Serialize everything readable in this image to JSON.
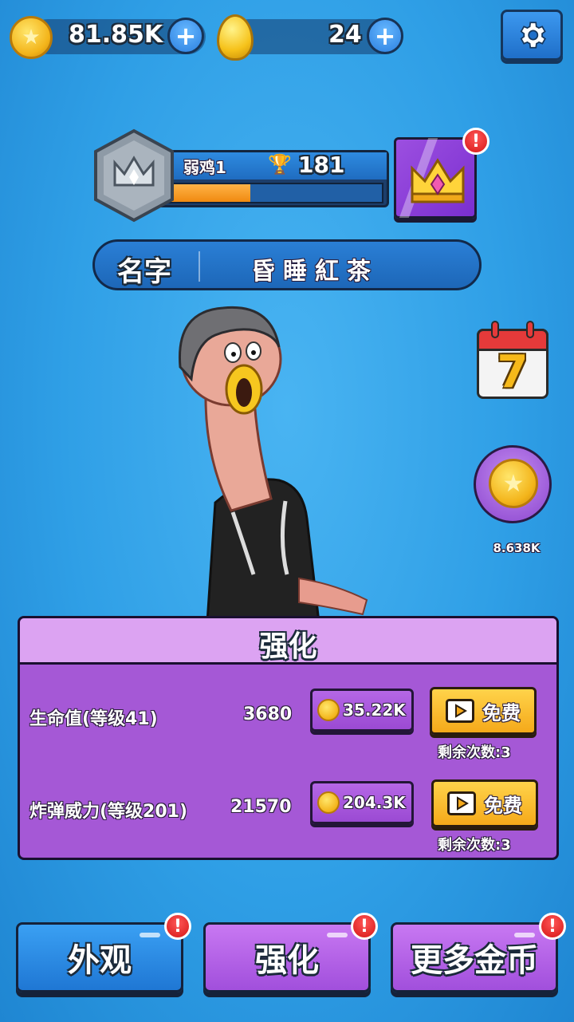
{
  "currency": {
    "coins": "81.85K",
    "gems": "24"
  },
  "profile": {
    "rank_name": "弱鸡1",
    "trophies": "181",
    "progress": 0.38,
    "name_label": "名字",
    "player_name": "昏睡紅茶"
  },
  "side": {
    "calendar_day": "7",
    "coin_bonus": "8.638K"
  },
  "upgrade": {
    "title": "强化",
    "rows": [
      {
        "label": "生命值(等级41)",
        "value": "3680",
        "cost": "35.22K",
        "free": "免费",
        "remaining": "剩余次数:3"
      },
      {
        "label": "炸弹威力(等级201)",
        "value": "21570",
        "cost": "204.3K",
        "free": "免费",
        "remaining": "剩余次数:3"
      }
    ]
  },
  "nav": {
    "appearance": "外观",
    "upgrade": "强化",
    "more_coins": "更多金币"
  },
  "colors": {
    "background": "#2f9fe6",
    "panel_purple": "#a558d6",
    "free_gold": "#f5a91a",
    "alert_red": "#d51616"
  }
}
